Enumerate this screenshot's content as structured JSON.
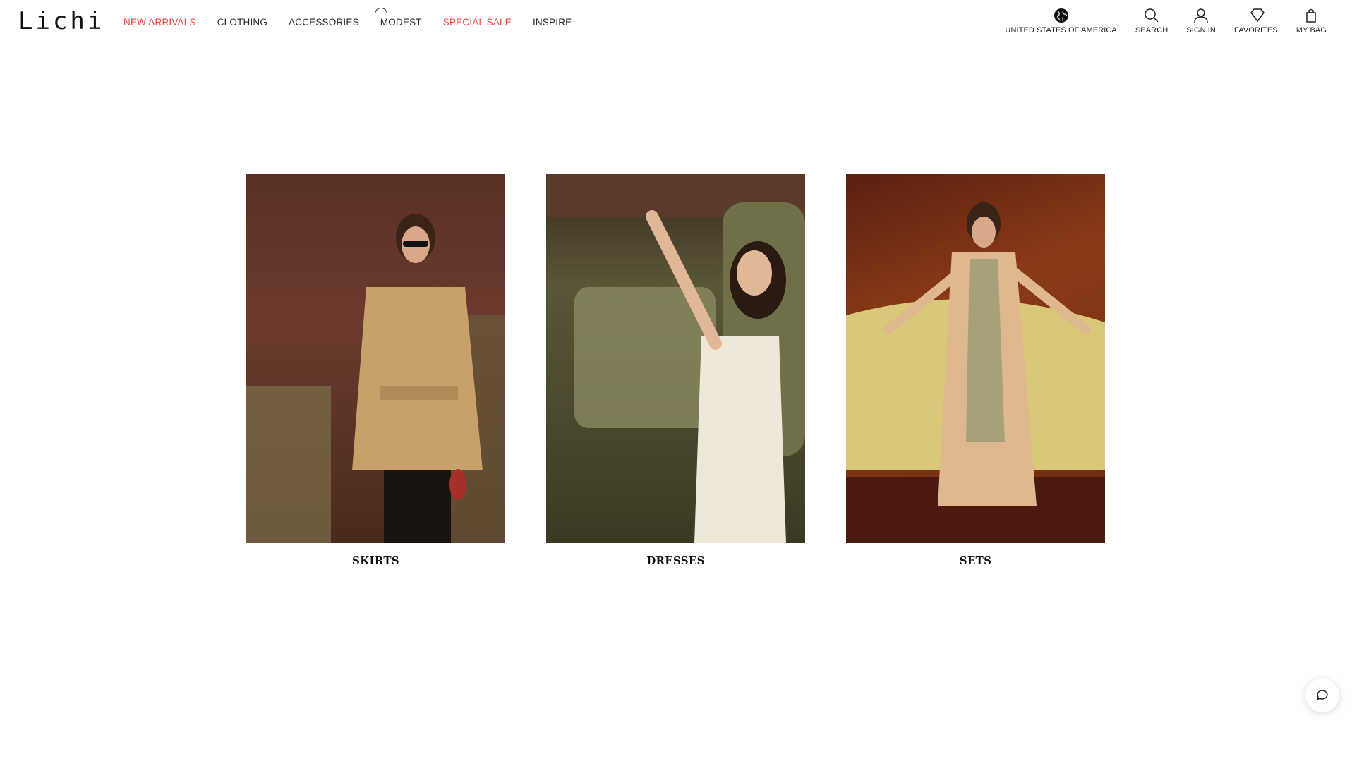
{
  "brand": {
    "logo_text": "Lichi"
  },
  "nav": {
    "items": [
      {
        "label": "NEW ARRIVALS",
        "color": "#e8453c"
      },
      {
        "label": "CLOTHING",
        "color": "#2a2a2a"
      },
      {
        "label": "ACCESSORIES",
        "color": "#2a2a2a"
      },
      {
        "label": "MODEST",
        "color": "#2a2a2a"
      },
      {
        "label": "SPECIAL SALE",
        "color": "#e8453c"
      },
      {
        "label": "INSPIRE",
        "color": "#2a2a2a"
      }
    ]
  },
  "utilities": {
    "region": {
      "label": "UNITED STATES OF AMERICA",
      "icon": "globe-icon"
    },
    "search": {
      "label": "SEARCH",
      "icon": "search-icon"
    },
    "account": {
      "label": "SIGN IN",
      "icon": "user-icon"
    },
    "favorites": {
      "label": "FAVORITES",
      "icon": "diamond-icon"
    },
    "bag": {
      "label": "MY BAG",
      "icon": "bag-icon"
    }
  },
  "categories": [
    {
      "label": "SKIRTS"
    },
    {
      "label": "DRESSES"
    },
    {
      "label": "SETS"
    }
  ],
  "chat": {
    "icon": "chat-icon"
  }
}
